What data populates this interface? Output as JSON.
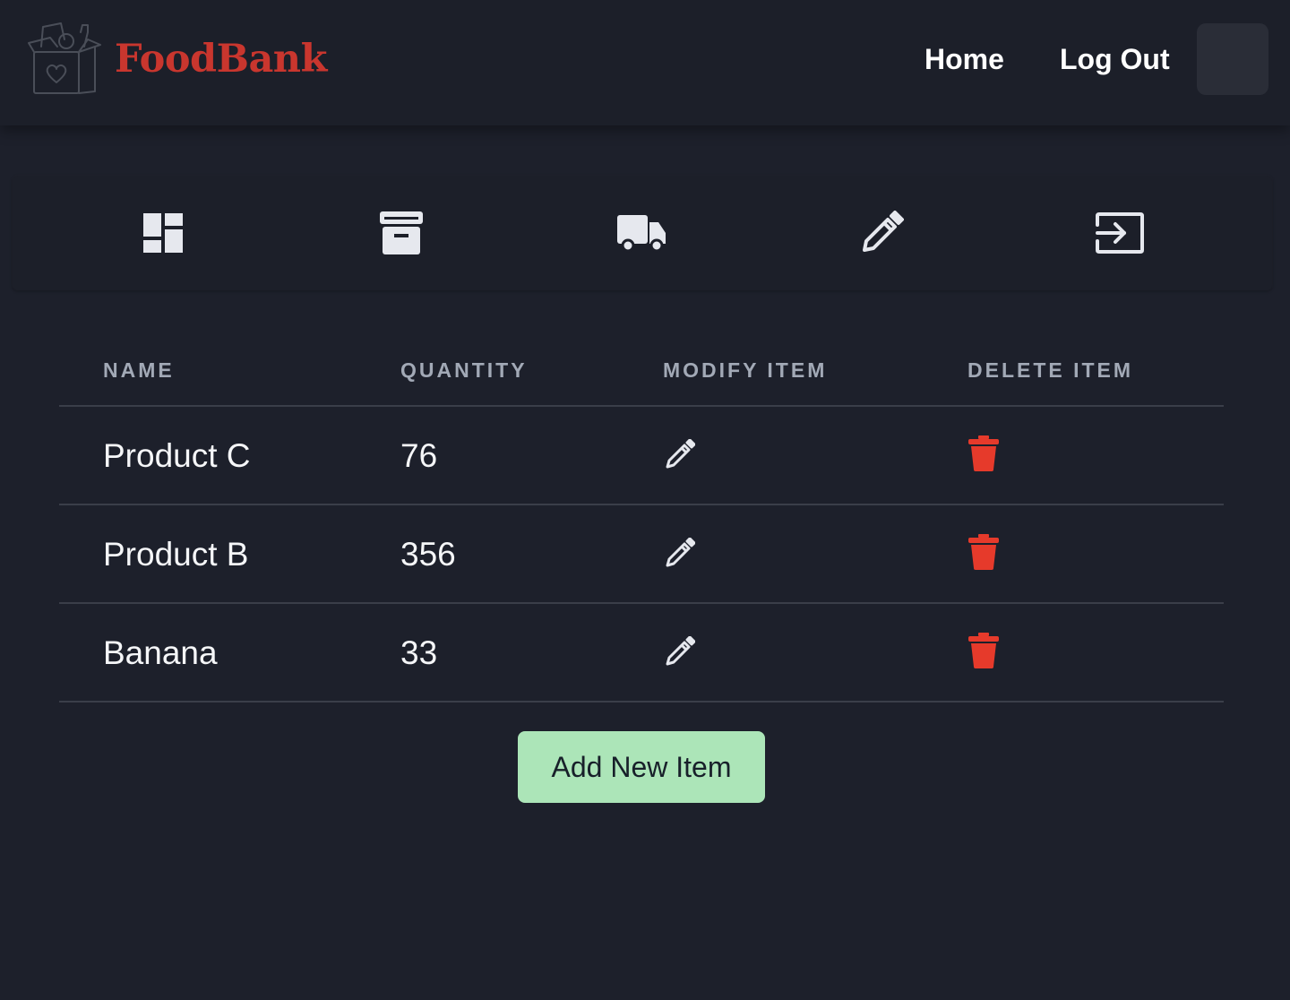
{
  "brand": {
    "name": "FoodBank",
    "logo_icon": "grocery-box-heart-icon",
    "color": "#c9362e"
  },
  "nav": {
    "home": "Home",
    "logout": "Log Out"
  },
  "toolbar": {
    "items": [
      {
        "icon": "dashboard-icon"
      },
      {
        "icon": "archive-icon"
      },
      {
        "icon": "truck-icon"
      },
      {
        "icon": "pencil-icon"
      },
      {
        "icon": "sign-in-icon"
      }
    ]
  },
  "table": {
    "headers": [
      "NAME",
      "QUANTITY",
      "MODIFY ITEM",
      "DELETE ITEM"
    ],
    "rows": [
      {
        "name": "Product C",
        "quantity": "76"
      },
      {
        "name": "Product B",
        "quantity": "356"
      },
      {
        "name": "Banana",
        "quantity": "33"
      }
    ]
  },
  "actions": {
    "add_new_item": "Add New Item"
  },
  "colors": {
    "background": "#1d202b",
    "delete": "#e63a2b",
    "add_button": "#ace5b8"
  }
}
